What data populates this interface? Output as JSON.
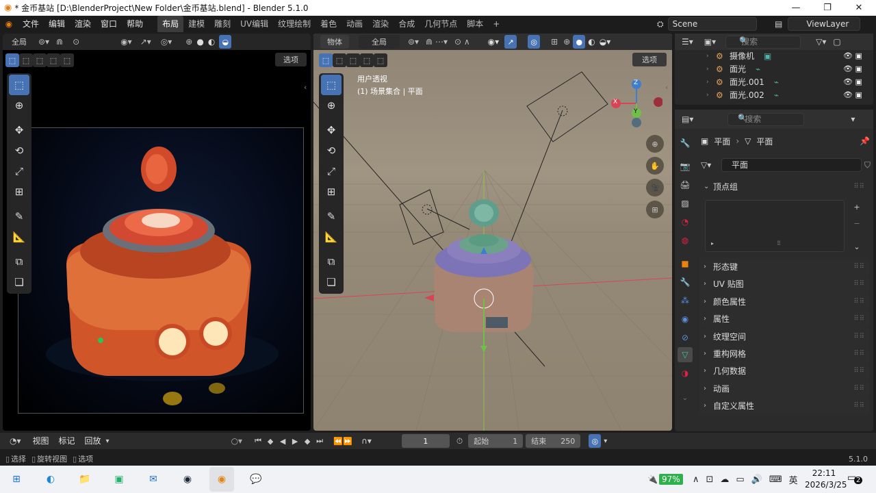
{
  "window": {
    "title": "* 金币基站 [D:\\BlenderProject\\New Folder\\金币基站.blend] - Blender 5.1.0",
    "minimize": "—",
    "maximize": "❐",
    "close": "✕"
  },
  "menu": {
    "file": "文件",
    "edit": "编辑",
    "render": "渲染",
    "window": "窗口",
    "help": "帮助"
  },
  "workspaces": [
    "布局",
    "建模",
    "雕刻",
    "UV编辑",
    "纹理绘制",
    "着色",
    "动画",
    "渲染",
    "合成",
    "几何节点",
    "脚本"
  ],
  "workspace_add": "+",
  "scene": {
    "name": "Scene",
    "viewlayer": "ViewLayer"
  },
  "left_view": {
    "mode": "全局",
    "options": "选项"
  },
  "main_view": {
    "mode": "物体",
    "orientation": "全局",
    "options": "选项",
    "perspective": "用户透视",
    "collection": "(1) 场景集合 | 平面",
    "gizmo_z": "Z",
    "gizmo_x": "X",
    "gizmo_y": "Y"
  },
  "outliner": {
    "search_placeholder": "搜索",
    "items": [
      "摄像机",
      "面光",
      "面光.001",
      "面光.002"
    ]
  },
  "properties": {
    "search_placeholder": "搜索",
    "breadcrumb_obj": "平面",
    "breadcrumb_data": "平面",
    "datablock": "平面",
    "vertex_groups": "顶点组",
    "sections": [
      "形态键",
      "UV 贴图",
      "颜色属性",
      "属性",
      "纹理空间",
      "重构网格",
      "几何数据",
      "动画",
      "自定义属性"
    ]
  },
  "timeline": {
    "view": "视图",
    "marker": "标记",
    "playback": "回放",
    "frame": "1",
    "start_label": "起始",
    "start": "1",
    "end_label": "结束",
    "end": "250"
  },
  "statusbar": {
    "select": "选择",
    "rotate": "旋转视图",
    "options": "选项",
    "version": "5.1.0"
  },
  "taskbar": {
    "battery": "97%",
    "ime": "英",
    "time": "22:11",
    "date": "2026/3/25",
    "notify": "2"
  },
  "colors": {
    "accent": "#4772b3",
    "active_tab": "#3c3c3c",
    "viewport_bg": "#9a8d78",
    "grid_floor": "#8e8370"
  }
}
